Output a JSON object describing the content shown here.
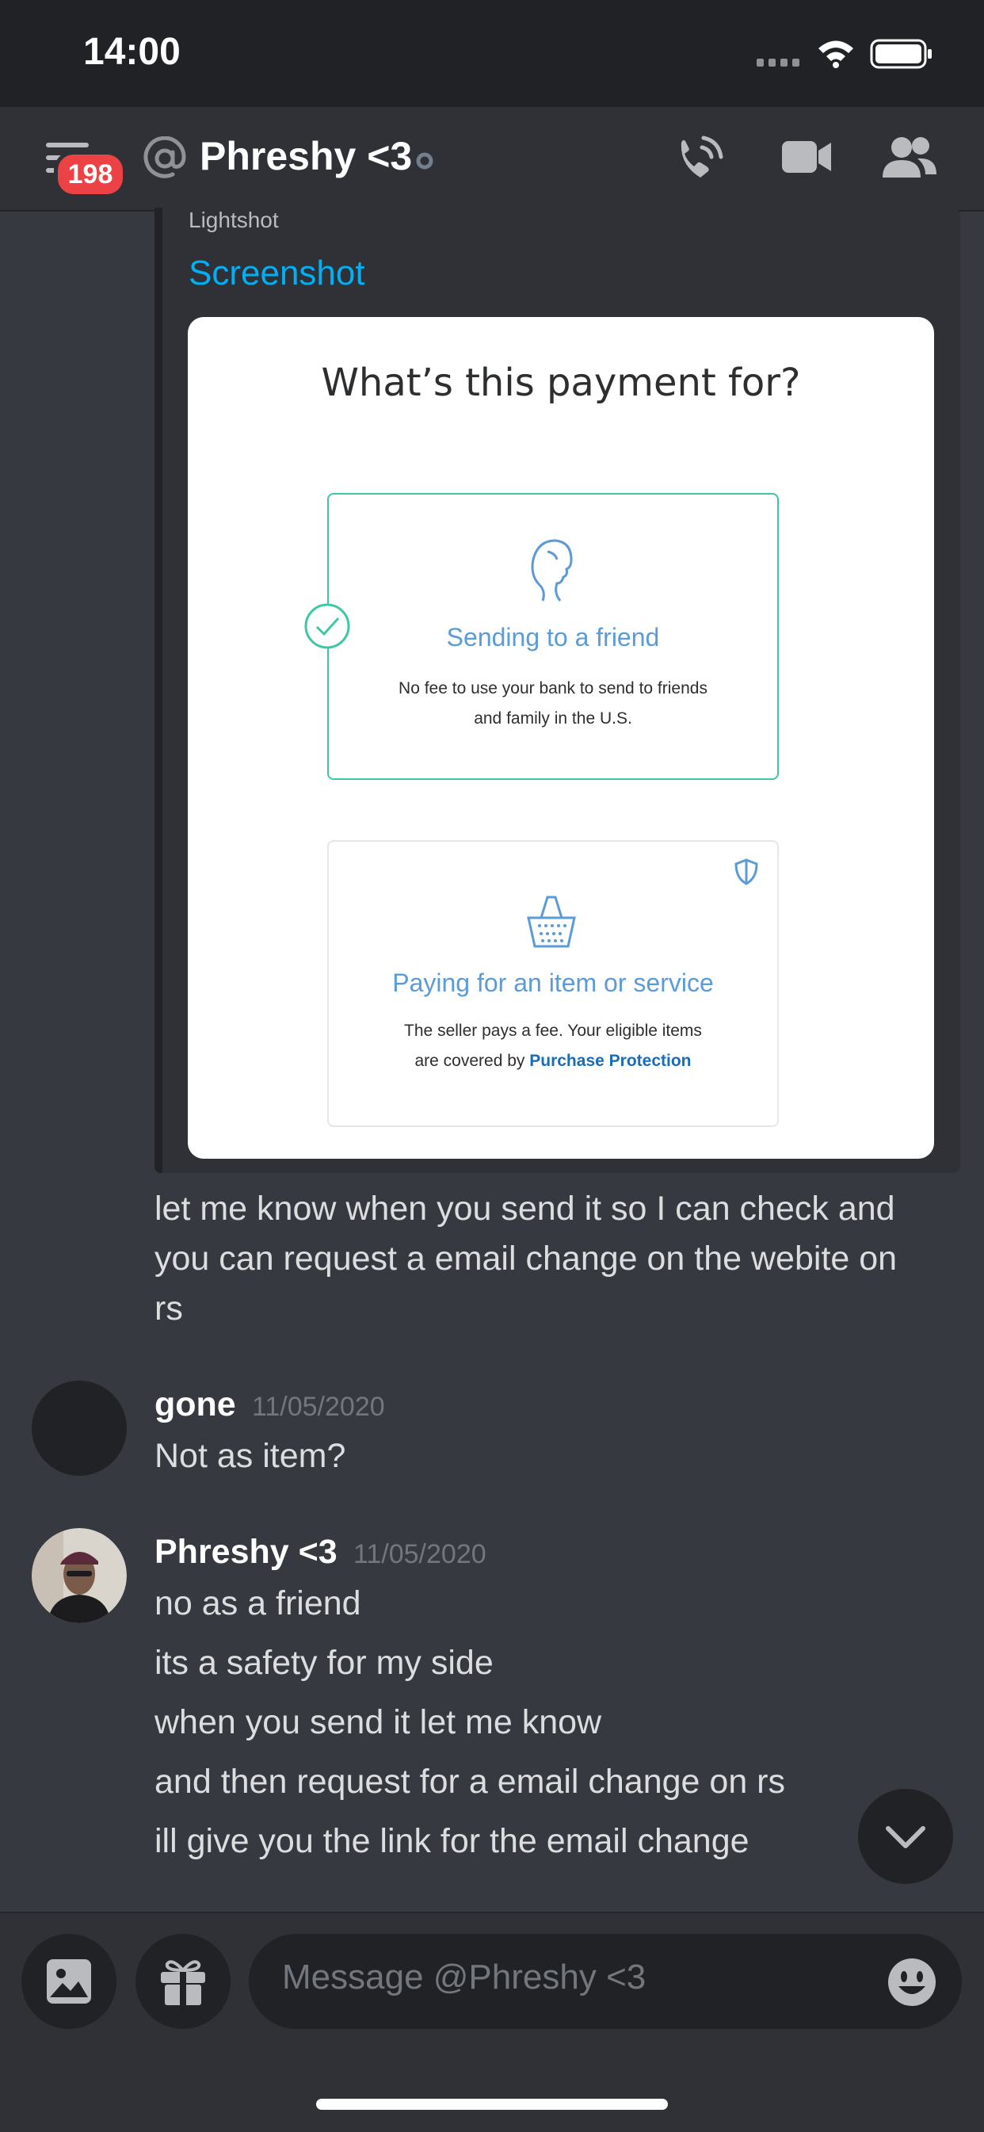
{
  "status_bar": {
    "time": "14:00"
  },
  "header": {
    "badge_count": "198",
    "channel_name": "Phreshy <3",
    "icons": [
      "menu-icon",
      "at-icon",
      "status-dot-icon",
      "call-icon",
      "video-icon",
      "members-icon"
    ]
  },
  "embed": {
    "provider": "Lightshot",
    "title": "Screenshot",
    "image": {
      "heading": "What’s this payment for?",
      "friend_option": {
        "title": "Sending to a friend",
        "desc_line1": "No fee to use your bank to send to friends",
        "desc_line2": "and family in the U.S."
      },
      "item_option": {
        "title": "Paying for an item or service",
        "desc_line1": "The seller pays a fee. Your eligible items",
        "desc_line2_prefix": "are covered by ",
        "desc_link": "Purchase Protection"
      }
    }
  },
  "messages": {
    "continuation": {
      "line1": "let me know when you send it so I can check and",
      "line2": "you can request a email change on the webite on",
      "line3": "rs"
    },
    "gone": {
      "username": "gone",
      "timestamp": "11/05/2020",
      "text": "Not as item?"
    },
    "phreshy": {
      "username": "Phreshy <3",
      "timestamp": "11/05/2020",
      "lines": [
        "no as a friend",
        "its a safety for my side",
        "when you send it let me know",
        "and then request for a email change on rs",
        "ill give you the link for the email change"
      ]
    }
  },
  "composer": {
    "placeholder": "Message @Phreshy <3"
  },
  "colors": {
    "background": "#36393f",
    "header": "#2f3136",
    "badge": "#ed4245",
    "link": "#00aff4",
    "paypal_green": "#3cc7a5",
    "paypal_blue": "#5a9bd8"
  }
}
